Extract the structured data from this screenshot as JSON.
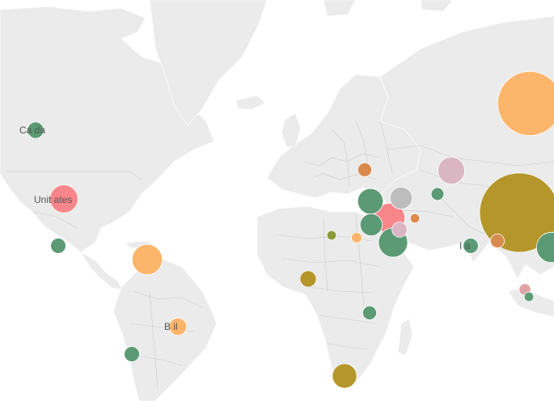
{
  "colors": {
    "land": "#ebebeb",
    "border": "#c9c9c9",
    "water": "#ffffff",
    "palette": [
      "#5b9a74",
      "#f7868a",
      "#fbb66b",
      "#b4962a",
      "#dab6c3",
      "#bdbdbd",
      "#d98b4f",
      "#8a9a3a",
      "#e0a3a3"
    ]
  },
  "labels": {
    "canada": "Ca   da",
    "united_states": "Unit       ates",
    "brazil": "B    il",
    "india": "I   a"
  },
  "bubbles": [
    {
      "name": "canada",
      "color": "#5b9a74",
      "size": 1.4
    },
    {
      "name": "united-states",
      "color": "#f7868a",
      "size": 2.4
    },
    {
      "name": "mexico",
      "color": "#5b9a74",
      "size": 1.3
    },
    {
      "name": "venezuela",
      "color": "#fbb66b",
      "size": 2.6
    },
    {
      "name": "brazil",
      "color": "#fbb66b",
      "size": 1.5
    },
    {
      "name": "chile",
      "color": "#5b9a74",
      "size": 1.3
    },
    {
      "name": "russia",
      "color": "#fbb66b",
      "size": 5.5
    },
    {
      "name": "china",
      "color": "#b4962a",
      "size": 6.8
    },
    {
      "name": "south-africa",
      "color": "#b4962a",
      "size": 2.1
    },
    {
      "name": "nigeria",
      "color": "#b4962a",
      "size": 1.4
    },
    {
      "name": "kenya",
      "color": "#5b9a74",
      "size": 1.2
    },
    {
      "name": "iran",
      "color": "#f7868a",
      "size": 2.6
    },
    {
      "name": "saudi-arabia",
      "color": "#5b9a74",
      "size": 2.5
    },
    {
      "name": "turkey",
      "color": "#5b9a74",
      "size": 2.2
    },
    {
      "name": "syria",
      "color": "#5b9a74",
      "size": 1.9
    },
    {
      "name": "kazakhstan",
      "color": "#dab6c3",
      "size": 2.3
    },
    {
      "name": "turkmenistan",
      "color": "#bdbdbd",
      "size": 1.9
    },
    {
      "name": "afghanistan",
      "color": "#dab6c3",
      "size": 1.3
    },
    {
      "name": "kyrgyzstan",
      "color": "#5b9a74",
      "size": 1.1
    },
    {
      "name": "ukraine",
      "color": "#d98b4f",
      "size": 1.2
    },
    {
      "name": "uzbekistan",
      "color": "#d98b4f",
      "size": 0.8
    },
    {
      "name": "egypt",
      "color": "#fbb66b",
      "size": 0.9
    },
    {
      "name": "libya",
      "color": "#8a9a3a",
      "size": 0.8
    },
    {
      "name": "nepal",
      "color": "#d98b4f",
      "size": 1.2
    },
    {
      "name": "india",
      "color": "#5b9a74",
      "size": 1.3
    },
    {
      "name": "vietnam",
      "color": "#e0a3a3",
      "size": 1.0
    },
    {
      "name": "thailand",
      "color": "#5b9a74",
      "size": 0.8
    },
    {
      "name": "taiwan",
      "color": "#5b9a74",
      "size": 2.6
    }
  ]
}
